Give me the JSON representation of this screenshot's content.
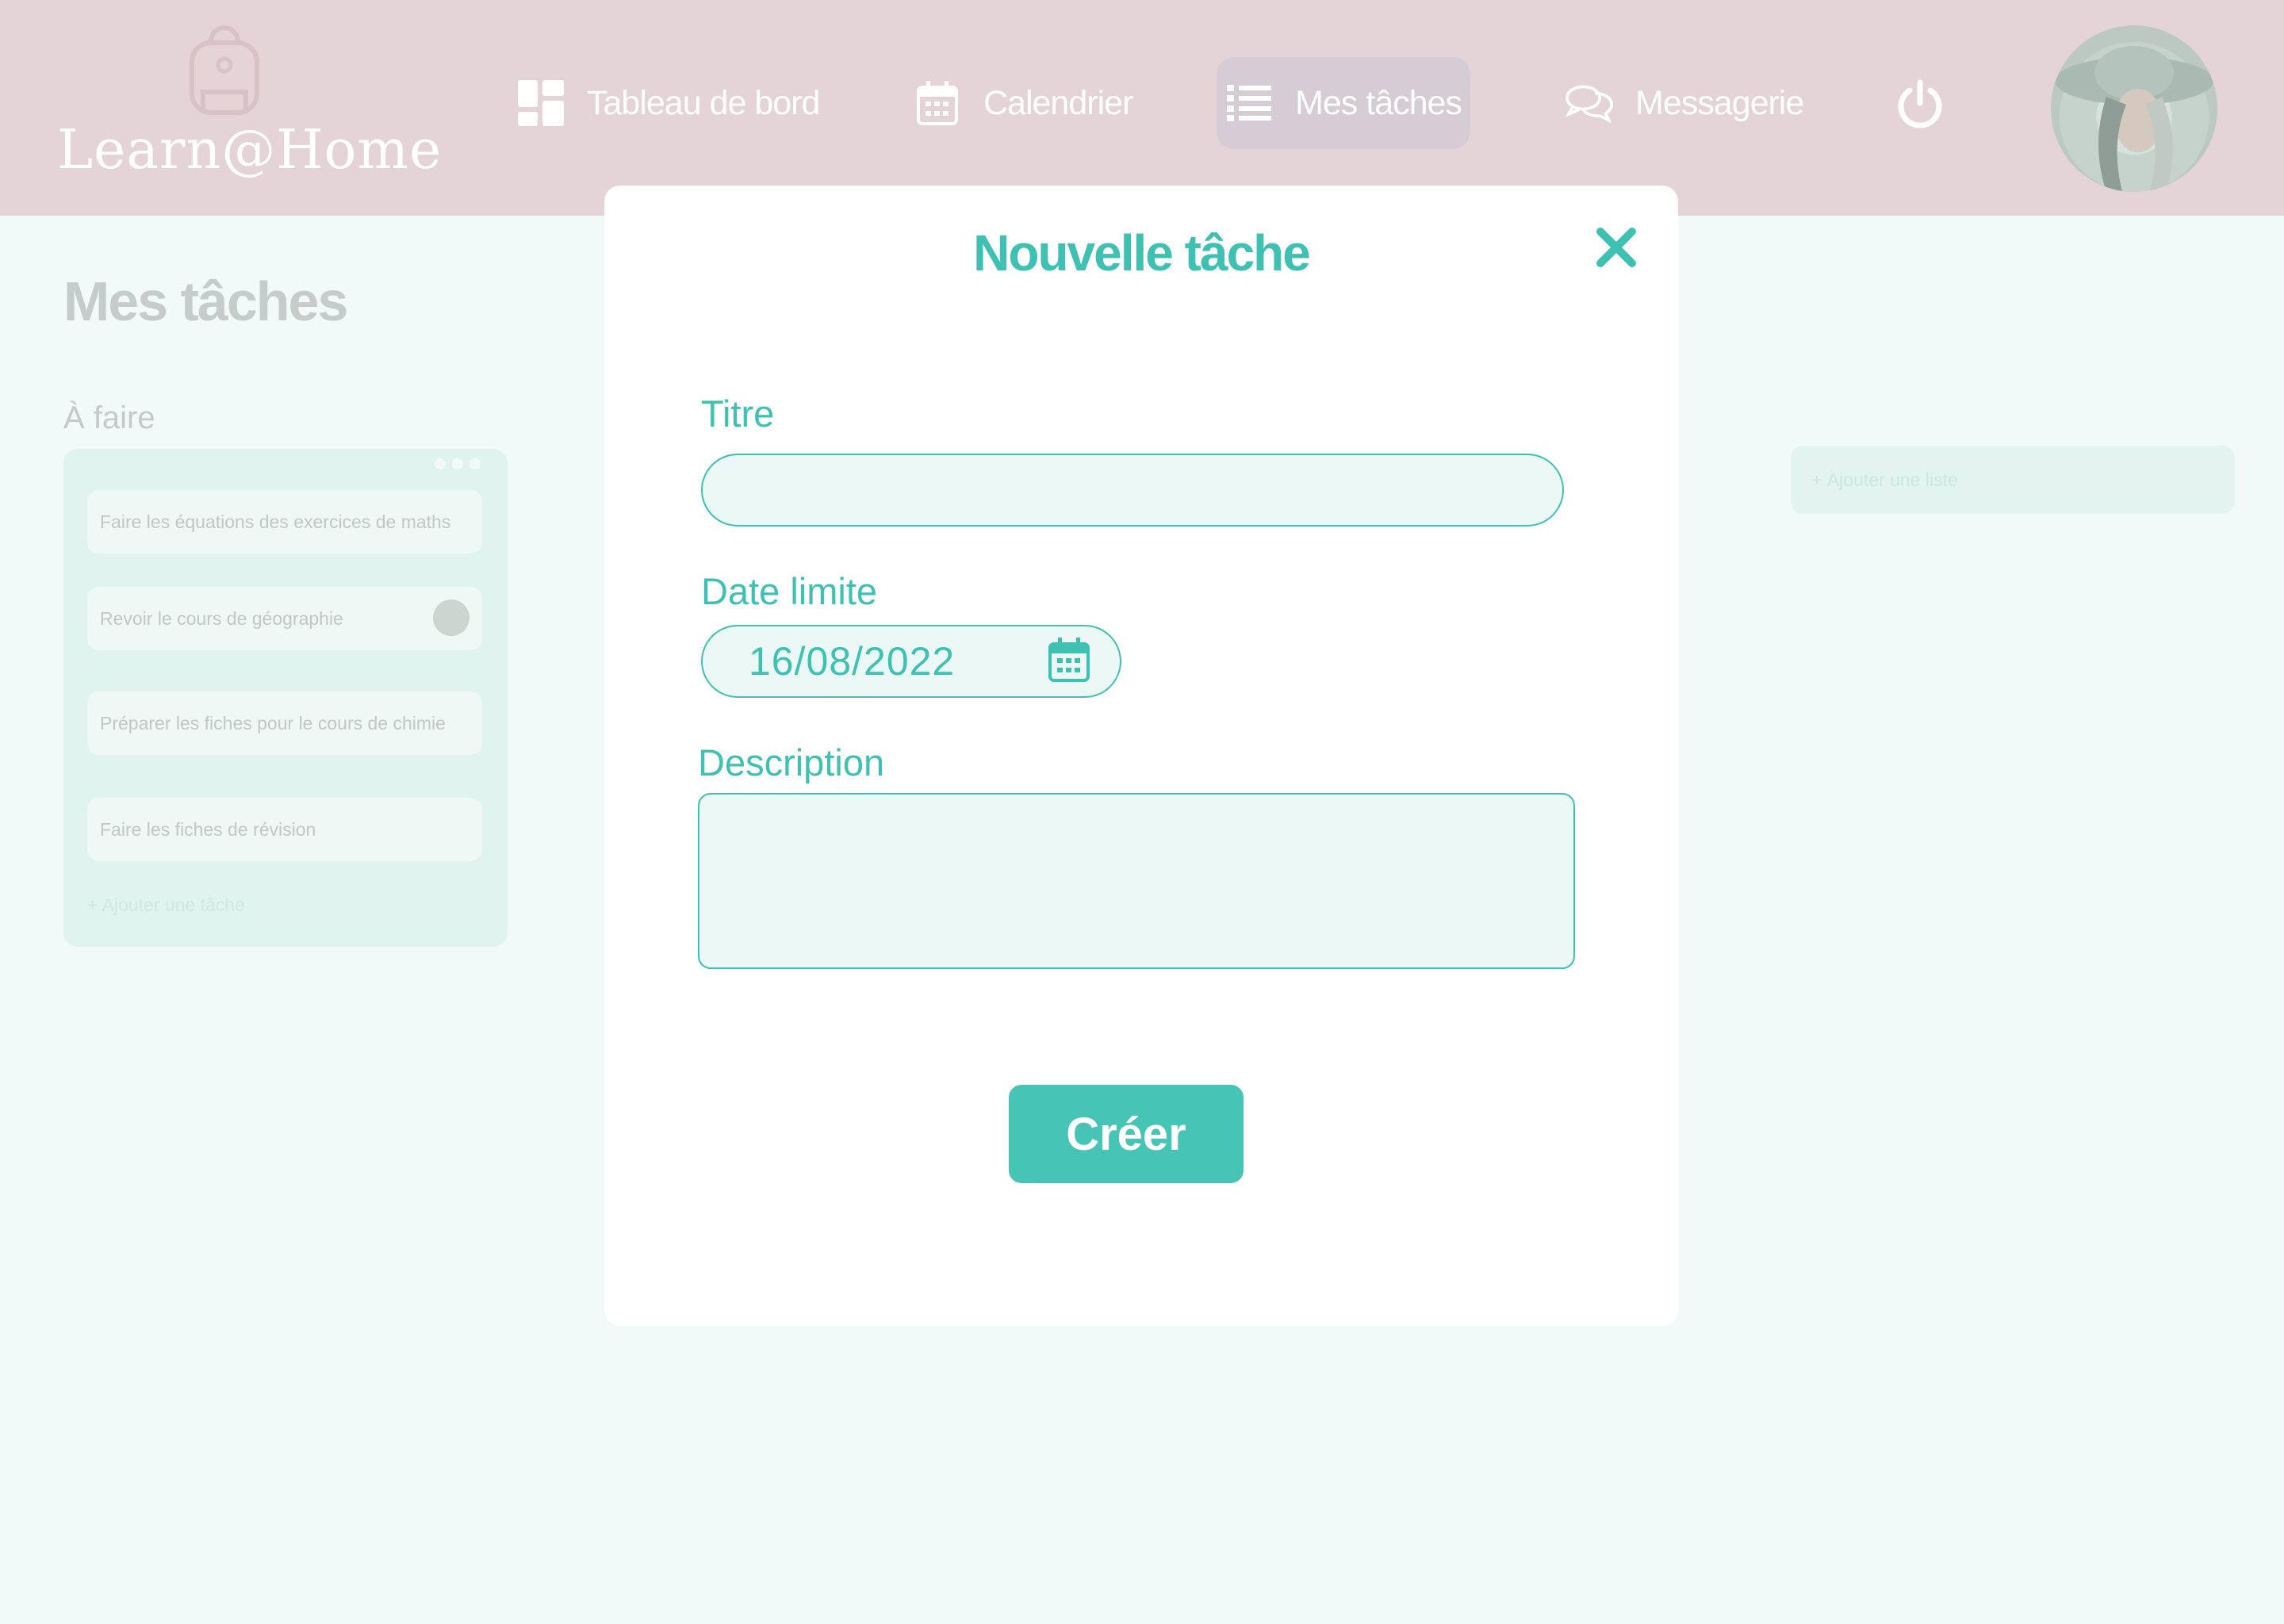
{
  "app": {
    "name": "Learn@Home"
  },
  "nav": {
    "items": [
      {
        "label": "Tableau de bord",
        "icon": "dashboard-icon"
      },
      {
        "label": "Calendrier",
        "icon": "calendar-icon"
      },
      {
        "label": "Mes tâches",
        "icon": "list-icon",
        "active": true
      },
      {
        "label": "Messagerie",
        "icon": "chat-icon"
      }
    ],
    "power_icon": "power-icon",
    "avatar": "user-avatar"
  },
  "page": {
    "title": "Mes tâches",
    "list": {
      "title": "À faire",
      "tasks": [
        "Faire les équations des exercices de maths",
        "Revoir le cours de géographie",
        "Préparer les fiches pour le cours de chimie",
        "Faire les fiches de révision"
      ],
      "add_task": "Ajouter une tâche"
    },
    "add_list": "Ajouter une liste"
  },
  "modal": {
    "title": "Nouvelle tâche",
    "fields": {
      "title_label": "Titre",
      "title_value": "",
      "date_label": "Date limite",
      "date_value": "16/08/2022",
      "description_label": "Description",
      "description_value": ""
    },
    "submit": "Créer"
  },
  "colors": {
    "accent": "#3ec1b2",
    "header": "#e4d4d7",
    "background": "#f1faf8"
  }
}
